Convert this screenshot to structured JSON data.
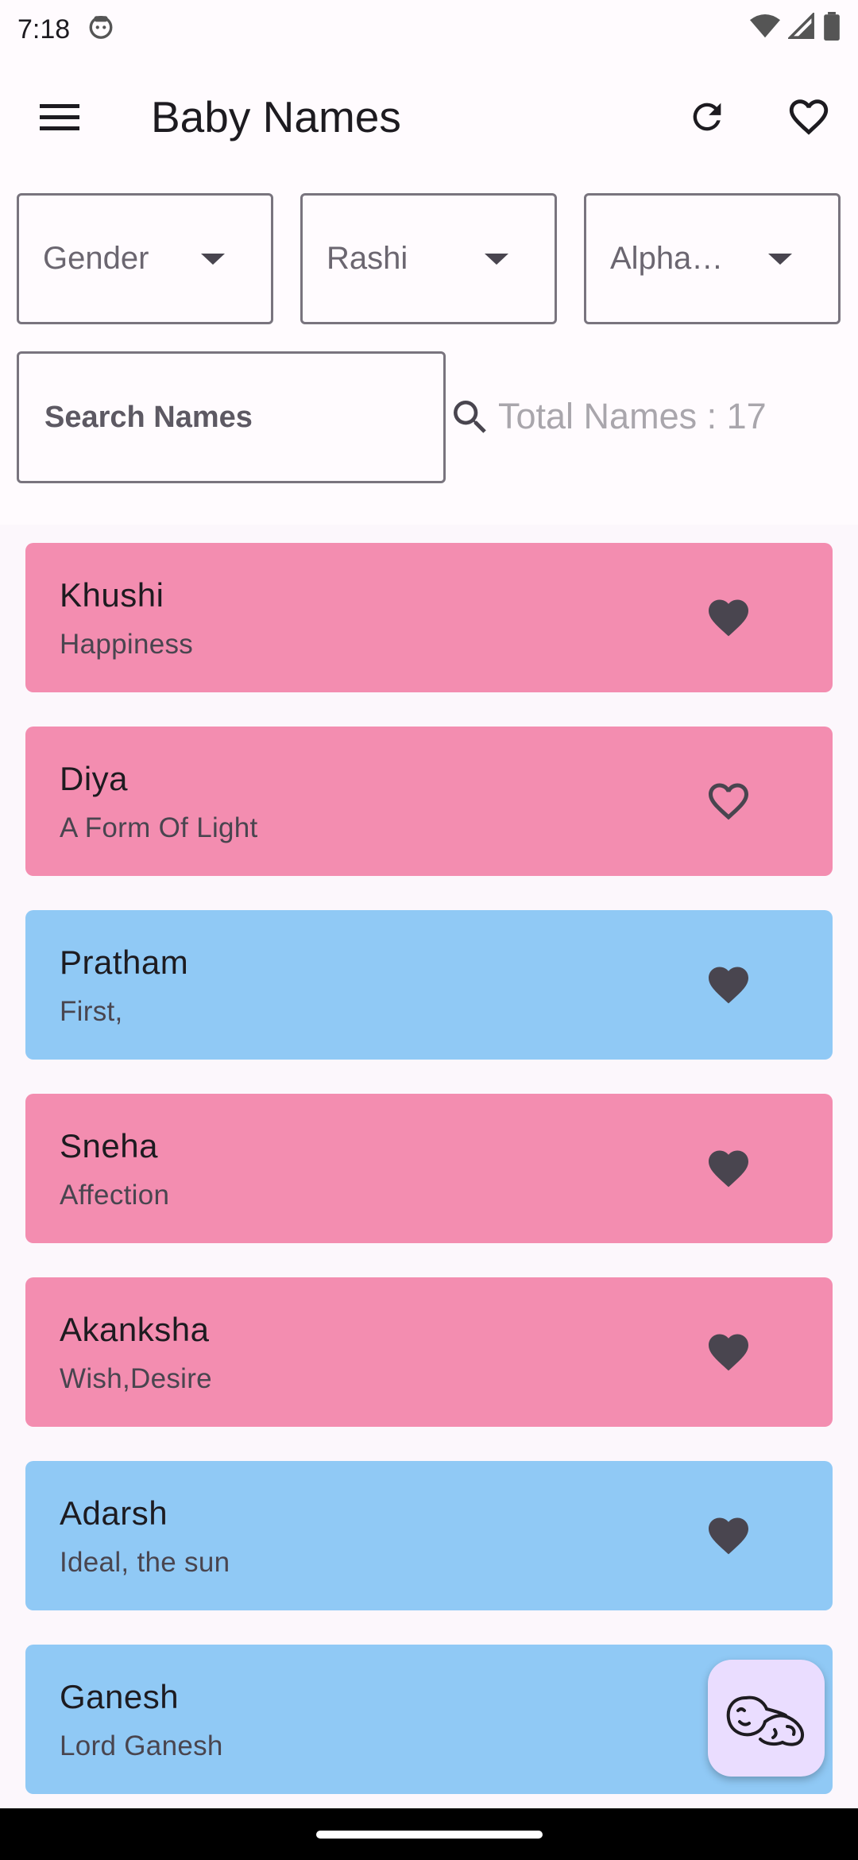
{
  "status_bar": {
    "time": "7:18"
  },
  "app_bar": {
    "title": "Baby Names"
  },
  "filters": {
    "gender": "Gender",
    "rashi": "Rashi",
    "alphabet": "Alpha…"
  },
  "search": {
    "placeholder": "Search Names",
    "value": ""
  },
  "total_label": "Total Names : 17",
  "colors": {
    "girl": "#f38db0",
    "boy": "#90c9f5",
    "heart": "#49454f",
    "fab": "#eaddff"
  },
  "names": [
    {
      "name": "Khushi",
      "meaning": "Happiness",
      "gender": "girl",
      "favorite": true
    },
    {
      "name": "Diya",
      "meaning": "A Form Of Light",
      "gender": "girl",
      "favorite": false
    },
    {
      "name": "Pratham",
      "meaning": "First,",
      "gender": "boy",
      "favorite": true
    },
    {
      "name": "Sneha",
      "meaning": "Affection",
      "gender": "girl",
      "favorite": true
    },
    {
      "name": "Akanksha",
      "meaning": "Wish,Desire",
      "gender": "girl",
      "favorite": true
    },
    {
      "name": "Adarsh",
      "meaning": "Ideal, the sun",
      "gender": "boy",
      "favorite": true
    },
    {
      "name": "Ganesh",
      "meaning": "Lord Ganesh",
      "gender": "boy",
      "favorite": true
    }
  ]
}
